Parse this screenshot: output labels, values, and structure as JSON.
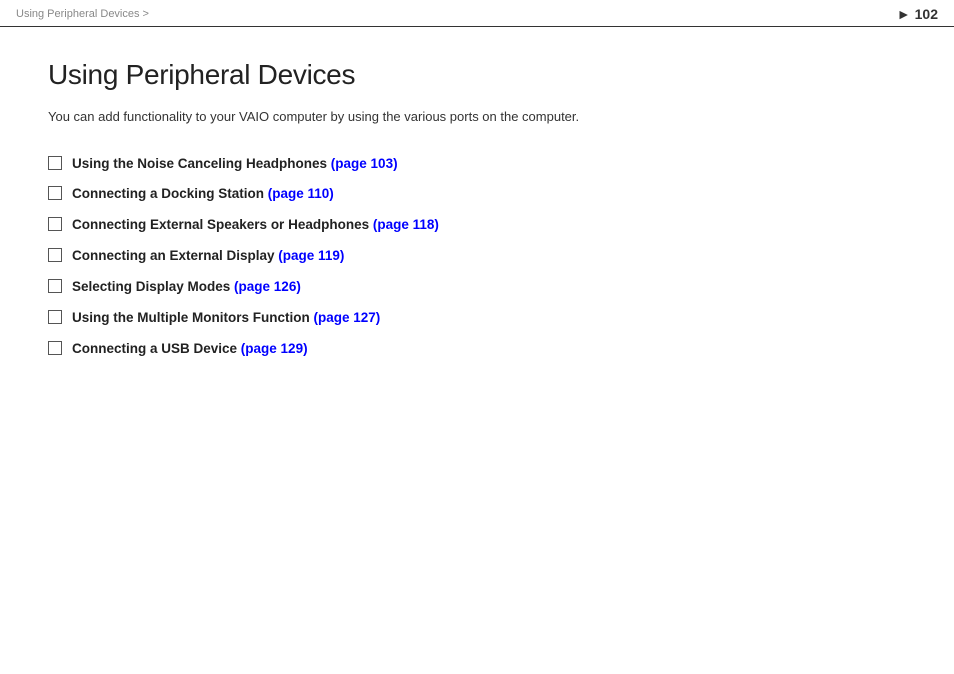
{
  "header": {
    "breadcrumb": "Using Peripheral Devices >",
    "page_number": "102"
  },
  "main": {
    "title": "Using Peripheral Devices",
    "intro": "You can add functionality to your VAIO computer by using the various ports on the computer.",
    "items": [
      {
        "label": "Using the Noise Canceling Headphones",
        "link_text": "(page 103)"
      },
      {
        "label": "Connecting a Docking Station",
        "link_text": "(page 110)"
      },
      {
        "label": "Connecting External Speakers or Headphones",
        "link_text": "(page 118)"
      },
      {
        "label": "Connecting an External Display",
        "link_text": "(page 119)"
      },
      {
        "label": "Selecting Display Modes",
        "link_text": "(page 126)"
      },
      {
        "label": "Using the Multiple Monitors Function",
        "link_text": "(page 127)"
      },
      {
        "label": "Connecting a USB Device",
        "link_text": "(page 129)"
      }
    ]
  }
}
